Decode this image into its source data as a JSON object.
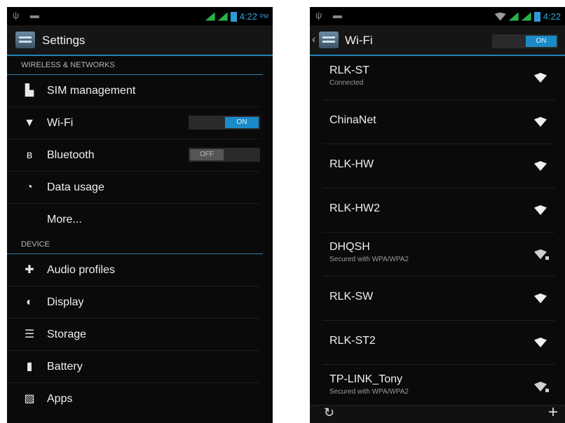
{
  "left": {
    "status": {
      "time": "4:22",
      "ampm": "PM"
    },
    "title": "Settings",
    "sections": {
      "wireless": "WIRELESS & NETWORKS",
      "device": "DEVICE"
    },
    "rows": {
      "sim": {
        "label": "SIM management",
        "icon": "sim-card-icon"
      },
      "wifi": {
        "label": "Wi-Fi",
        "icon": "wifi-icon",
        "toggle": "ON"
      },
      "bluetooth": {
        "label": "Bluetooth",
        "icon": "bluetooth-icon",
        "toggle": "OFF"
      },
      "data": {
        "label": "Data usage",
        "icon": "data-usage-icon"
      },
      "more": {
        "label": "More..."
      },
      "audio": {
        "label": "Audio profiles",
        "icon": "audio-profiles-icon"
      },
      "display": {
        "label": "Display",
        "icon": "display-icon"
      },
      "storage": {
        "label": "Storage",
        "icon": "storage-icon"
      },
      "battery": {
        "label": "Battery",
        "icon": "battery-icon"
      },
      "apps": {
        "label": "Apps",
        "icon": "apps-icon"
      }
    }
  },
  "right": {
    "status": {
      "time": "4:22"
    },
    "title": "Wi-Fi",
    "toggle": "ON",
    "networks": [
      {
        "name": "RLK-ST",
        "sub": "Connected"
      },
      {
        "name": "ChinaNet",
        "sub": ""
      },
      {
        "name": "RLK-HW",
        "sub": ""
      },
      {
        "name": "RLK-HW2",
        "sub": ""
      },
      {
        "name": "DHQSH",
        "sub": "Secured with WPA/WPA2"
      },
      {
        "name": "RLK-SW",
        "sub": ""
      },
      {
        "name": "RLK-ST2",
        "sub": ""
      },
      {
        "name": "TP-LINK_Tony",
        "sub": "Secured with WPA/WPA2"
      }
    ]
  },
  "colors": {
    "accent": "#1a8bc8",
    "background": "#0a0a0a",
    "signal": "#27b34a"
  }
}
